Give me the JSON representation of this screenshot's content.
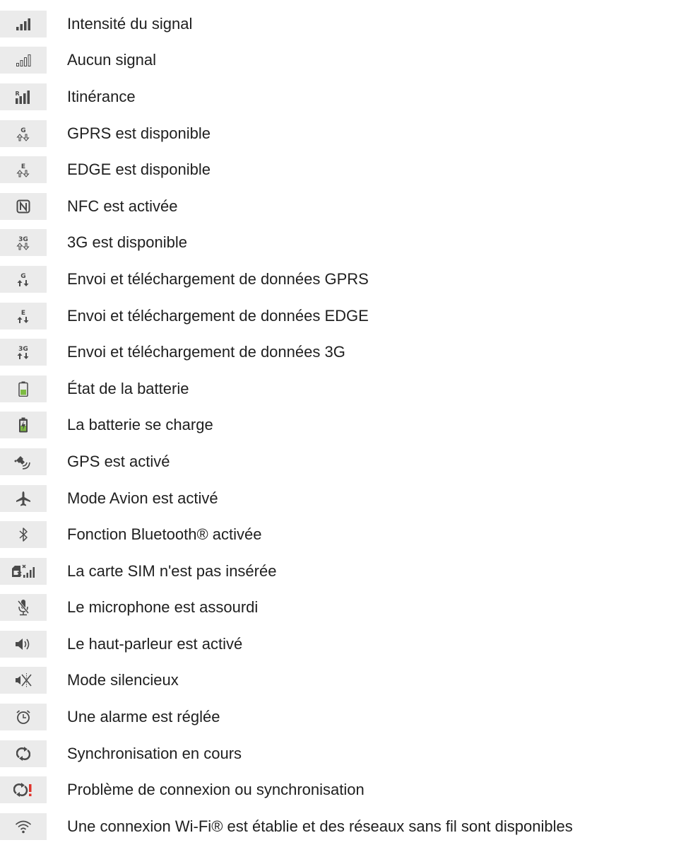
{
  "colors": {
    "icon_background": "#ebebeb",
    "icon_color": "#4a4a4a",
    "battery_green": "#7dbb42",
    "alert_red": "#e0332b",
    "text": "#1f1f1f"
  },
  "items": [
    {
      "icon": "signal-strength-icon",
      "label": "Intensité du signal"
    },
    {
      "icon": "no-signal-icon",
      "label": "Aucun signal"
    },
    {
      "icon": "roaming-icon",
      "label": "Itinérance"
    },
    {
      "icon": "gprs-icon",
      "icon_text": "G",
      "label": "GPRS est disponible"
    },
    {
      "icon": "edge-icon",
      "icon_text": "E",
      "label": "EDGE est disponible"
    },
    {
      "icon": "nfc-icon",
      "label": "NFC est activée"
    },
    {
      "icon": "3g-icon",
      "icon_text": "3G",
      "label": "3G est disponible"
    },
    {
      "icon": "gprs-data-icon",
      "icon_text": "G",
      "label": "Envoi et téléchargement de données GPRS"
    },
    {
      "icon": "edge-data-icon",
      "icon_text": "E",
      "label": "Envoi et téléchargement de données EDGE"
    },
    {
      "icon": "3g-data-icon",
      "icon_text": "3G",
      "label": "Envoi et téléchargement de données 3G"
    },
    {
      "icon": "battery-icon",
      "label": "État de la batterie"
    },
    {
      "icon": "battery-charging-icon",
      "label": "La batterie se charge"
    },
    {
      "icon": "gps-icon",
      "label": "GPS est activé"
    },
    {
      "icon": "airplane-icon",
      "label": "Mode Avion est activé"
    },
    {
      "icon": "bluetooth-icon",
      "label": "Fonction Bluetooth® activée"
    },
    {
      "icon": "no-sim-icon",
      "label": "La carte SIM n'est pas insérée"
    },
    {
      "icon": "mic-muted-icon",
      "label": "Le microphone est assourdi"
    },
    {
      "icon": "speaker-icon",
      "label": "Le haut-parleur est activé"
    },
    {
      "icon": "silent-mode-icon",
      "label": "Mode silencieux"
    },
    {
      "icon": "alarm-icon",
      "label": "Une alarme est réglée"
    },
    {
      "icon": "sync-icon",
      "label": "Synchronisation en cours"
    },
    {
      "icon": "sync-error-icon",
      "label": "Problème de connexion ou synchronisation"
    },
    {
      "icon": "wifi-icon",
      "label": "Une connexion Wi-Fi® est établie et des réseaux sans fil sont disponibles"
    }
  ]
}
